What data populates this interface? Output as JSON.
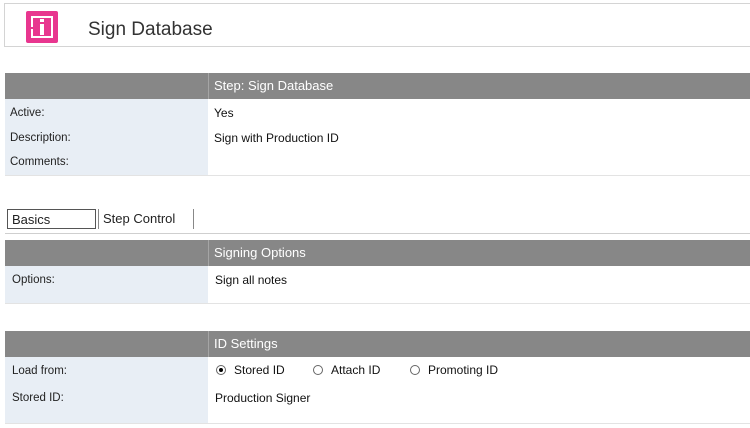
{
  "header": {
    "title": "Sign Database",
    "logo_icon": "agent-info-icon",
    "logo_color": "#e8368f"
  },
  "step": {
    "header": "Step:  Sign Database",
    "fields": [
      {
        "label": "Active:",
        "value": "Yes"
      },
      {
        "label": "Description:",
        "value": "Sign with Production ID"
      },
      {
        "label": "Comments:",
        "value": ""
      }
    ]
  },
  "tabs": [
    {
      "label": "Basics",
      "active": true
    },
    {
      "label": "Step Control",
      "active": false
    }
  ],
  "signing": {
    "header": "Signing Options",
    "options_label": "Options:",
    "options_value": "Sign all notes"
  },
  "id_settings": {
    "header": "ID Settings",
    "load_from_label": "Load from:",
    "radios": [
      {
        "label": "Stored ID",
        "checked": true
      },
      {
        "label": "Attach ID",
        "checked": false
      },
      {
        "label": "Promoting ID",
        "checked": false
      }
    ],
    "stored_id_label": "Stored ID:",
    "stored_id_value": "Production Signer"
  },
  "colors": {
    "band": "#878787",
    "label_column": "#e8eef5"
  }
}
